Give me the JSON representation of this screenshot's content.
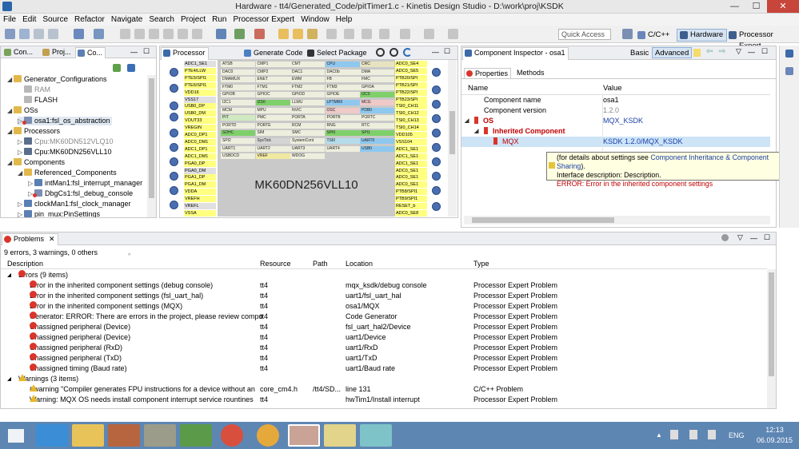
{
  "window": {
    "title": "Hardware - tt4/Generated_Code/pitTimer1.c - Kinetis Design Studio - D:\\work\\proj\\KSDK",
    "minimize": "—",
    "maximize": "☐",
    "close": "✕"
  },
  "menu": [
    "File",
    "Edit",
    "Source",
    "Refactor",
    "Navigate",
    "Search",
    "Project",
    "Run",
    "Processor Expert",
    "Window",
    "Help"
  ],
  "toolbar": {
    "quick_access": "Quick Access",
    "perspectives": [
      {
        "label": "C/C++",
        "active": false
      },
      {
        "label": "Hardware",
        "active": true
      },
      {
        "label": "Processor Expert",
        "active": false
      }
    ]
  },
  "components_panel": {
    "tabs": [
      "Con...",
      "Proj...",
      "Co..."
    ],
    "tree": [
      {
        "label": "Generator_Configurations",
        "level": 0,
        "twisty": "◢",
        "icon": "folder"
      },
      {
        "label": "RAM",
        "level": 1,
        "twisty": "",
        "icon": "gray",
        "muted": true
      },
      {
        "label": "FLASH",
        "level": 1,
        "twisty": "",
        "icon": "gray",
        "muted": false
      },
      {
        "label": "OSs",
        "level": 0,
        "twisty": "◢",
        "icon": "folder"
      },
      {
        "label": "osa1:fsl_os_abstraction",
        "level": 1,
        "twisty": "▷",
        "icon": "error",
        "selected": true
      },
      {
        "label": "Processors",
        "level": 0,
        "twisty": "◢",
        "icon": "folder"
      },
      {
        "label": "Cpu:MK60DN512VLQ10",
        "level": 1,
        "twisty": "▷",
        "icon": "cpu",
        "muted": true
      },
      {
        "label": "Cpu:MK60DN256VLL10",
        "level": 1,
        "twisty": "▷",
        "icon": "cpu"
      },
      {
        "label": "Components",
        "level": 0,
        "twisty": "◢",
        "icon": "folder"
      },
      {
        "label": "Referenced_Components",
        "level": 1,
        "twisty": "◢",
        "icon": "folder"
      },
      {
        "label": "intMan1:fsl_interrupt_manager",
        "level": 2,
        "twisty": "▷",
        "icon": "comp"
      },
      {
        "label": "DbgCs1:fsl_debug_console",
        "level": 2,
        "twisty": "▷",
        "icon": "error"
      },
      {
        "label": "clockMan1:fsl_clock_manager",
        "level": 1,
        "twisty": "▷",
        "icon": "comp"
      },
      {
        "label": "pin_mux:PinSettings",
        "level": 1,
        "twisty": "▷",
        "icon": "comp"
      }
    ]
  },
  "processor_panel": {
    "tab": "Processor",
    "generate_code": "Generate Code",
    "select_package": "Select Package",
    "chip_name": "MK60DN256VLL10",
    "left_pins": [
      "ADC1_SE1",
      "PTE4/LLW",
      "PTE5/SPI1",
      "PTE6/SPI1",
      "VDD16",
      "VSS17",
      "USB0_DP",
      "USB0_DM",
      "VOUT33",
      "VREGIN",
      "ADC0_DP1",
      "ADC0_DM1",
      "ADC1_DP1",
      "ADC1_DM1",
      "PGA0_DP",
      "PGA0_DM",
      "PGA1_DP",
      "PGA1_DM",
      "VDDA",
      "VREFH",
      "VREFL",
      "VSSA"
    ],
    "right_pins": [
      "ADC0_SE4",
      "ADC0_SE5",
      "PTB20/SPI",
      "PTB21/SPI",
      "PTB22/SPI",
      "PTB23/SPI",
      "TSI0_CH11",
      "TSI0_CH12",
      "TSI0_CH13",
      "TSI0_CH14",
      "VDD105",
      "VSS104",
      "ADC1_SE1",
      "ADC1_SE1",
      "ADC1_SE1",
      "ADC0_SE1",
      "ADC0_SE1",
      "ADC0_SE1",
      "PTB8/SPI1",
      "PTB9/SPI1",
      "RESET_b",
      "ADC0_SE8"
    ],
    "modules": [
      [
        "ATSB",
        "CMP1",
        "CMT",
        "CPU",
        "CRC"
      ],
      [
        "DAC0",
        "CMP2",
        "DAC1",
        "DAC0b",
        "DMA"
      ],
      [
        "DMAMUX",
        "ENET",
        "EWM",
        "FB",
        "FMC"
      ],
      [
        "FTM0",
        "FTM1",
        "FTM2",
        "FTM3",
        "GPIOA"
      ],
      [
        "GPIOB",
        "GPIOC",
        "GPIOD",
        "GPIOE",
        "I2C0"
      ],
      [
        "I2C1",
        "I2S0",
        "LLWU",
        "LPTMR0",
        "MCG"
      ],
      [
        "MCM",
        "MPU",
        "NVIC",
        "OSC",
        "PDB0"
      ],
      [
        "PIT",
        "PMC",
        "PORTA",
        "PORTB",
        "PORTC"
      ],
      [
        "PORTD",
        "PORTE",
        "RCM",
        "RNG",
        "RTC"
      ],
      [
        "SDHC",
        "SIM",
        "SMC",
        "SPI0",
        "SPI1"
      ],
      [
        "SPI2",
        "SysTick",
        "SystemCont",
        "TSI0",
        "UART0"
      ],
      [
        "UART1",
        "UART2",
        "UART3",
        "UART4",
        "USB0"
      ],
      [
        "USBDCD",
        "VREF",
        "WDOG",
        "",
        ""
      ]
    ]
  },
  "inspector": {
    "tab": "Component Inspector - osa1",
    "basic": "Basic",
    "advanced": "Advanced",
    "subtabs": [
      "Properties",
      "Methods"
    ],
    "col_name": "Name",
    "col_value": "Value",
    "rows": [
      {
        "name": "Component name",
        "value": "osa1",
        "indent": 1,
        "twisty": "",
        "err": false,
        "muted": false
      },
      {
        "name": "Component version",
        "value": "1.2.0",
        "indent": 1,
        "twisty": "",
        "err": false,
        "muted": true
      },
      {
        "name": "OS",
        "value": "MQX_KSDK",
        "indent": 0,
        "twisty": "◢",
        "err": true,
        "link": true
      },
      {
        "name": "Inherited Component",
        "value": "",
        "indent": 1,
        "twisty": "◢",
        "err": true
      },
      {
        "name": "MQX",
        "value": "KSDK 1.2.0/MQX_KSDK",
        "indent": 2,
        "twisty": "",
        "err": true,
        "link": true,
        "selected": true
      }
    ],
    "tooltip": {
      "line1a": "(for details about settings see ",
      "line1b": "Component Inheritance & Component Sharing",
      "line1c": ").",
      "line2": "Interface description: Description.",
      "line3": "ERROR: Error in the inherited component settings"
    }
  },
  "problems": {
    "tab": "Problems",
    "summary": "9 errors, 3 warnings, 0 others",
    "columns": [
      "Description",
      "Resource",
      "Path",
      "Location",
      "Type"
    ],
    "error_group": "Errors (9 items)",
    "errors": [
      [
        "Error in the inherited component settings (debug console)",
        "tt4",
        "",
        "mqx_ksdk/debug console",
        "Processor Expert Problem"
      ],
      [
        "Error in the inherited component settings (fsl_uart_hal)",
        "tt4",
        "",
        "uart1/fsl_uart_hal",
        "Processor Expert Problem"
      ],
      [
        "Error in the inherited component settings (MQX)",
        "tt4",
        "",
        "osa1/MQX",
        "Processor Expert Problem"
      ],
      [
        "Generator: ERROR: There are errors in the project, please review compo",
        "tt4",
        "",
        "Code Generator",
        "Processor Expert Problem"
      ],
      [
        "Unassigned peripheral (Device)",
        "tt4",
        "",
        "fsl_uart_hal2/Device",
        "Processor Expert Problem"
      ],
      [
        "Unassigned peripheral (Device)",
        "tt4",
        "",
        "uart1/Device",
        "Processor Expert Problem"
      ],
      [
        "Unassigned peripheral (RxD)",
        "tt4",
        "",
        "uart1/RxD",
        "Processor Expert Problem"
      ],
      [
        "Unassigned peripheral (TxD)",
        "tt4",
        "",
        "uart1/TxD",
        "Processor Expert Problem"
      ],
      [
        "Unassigned timing (Baud rate)",
        "tt4",
        "",
        "uart1/Baud rate",
        "Processor Expert Problem"
      ]
    ],
    "warning_group": "Warnings (3 items)",
    "warnings": [
      [
        "#warning \"Compiler generates FPU instructions for a device without an",
        "core_cm4.h",
        "/tt4/SD...",
        "line 131",
        "C/C++ Problem"
      ],
      [
        "Warning: MQX OS needs install component interrupt service rountines",
        "tt4",
        "",
        "hwTim1/Install interrupt",
        "Processor Expert Problem"
      ]
    ]
  },
  "taskbar": {
    "time": "12:13",
    "date": "06.09.2015",
    "lang": "ENG"
  },
  "colors": {
    "error": "#d9352b",
    "link": "#1a3fa8",
    "selected_row": "#cde4f7",
    "taskbar": "#5e86b3",
    "chip": "#c9c9c9"
  }
}
